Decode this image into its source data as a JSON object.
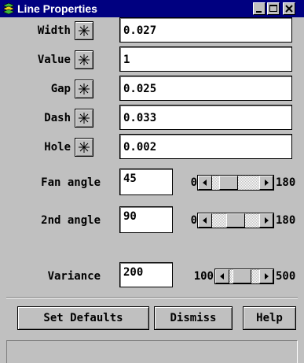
{
  "window": {
    "title": "Line Properties",
    "icon": "stacked-layers-icon",
    "controls": [
      "minimize-icon",
      "maximize-icon",
      "close-icon"
    ]
  },
  "properties": [
    {
      "label": "Width",
      "value": "0.027",
      "picker_icon": "crosshair-star-icon"
    },
    {
      "label": "Value",
      "value": "1",
      "picker_icon": "crosshair-star-icon"
    },
    {
      "label": "Gap",
      "value": "0.025",
      "picker_icon": "crosshair-star-icon"
    },
    {
      "label": "Dash",
      "value": "0.033",
      "picker_icon": "crosshair-star-icon"
    },
    {
      "label": "Hole",
      "value": "0.002",
      "picker_icon": "crosshair-star-icon"
    }
  ],
  "scales": [
    {
      "label": "Fan angle",
      "value": "45",
      "min": "0",
      "max": "180",
      "position": 0.25
    },
    {
      "label": "2nd angle",
      "value": "90",
      "min": "0",
      "max": "180",
      "position": 0.5
    },
    {
      "label": "Variance",
      "value": "200",
      "min": "100",
      "max": "500",
      "position": 0.25
    }
  ],
  "buttons": {
    "set_defaults": "Set Defaults",
    "dismiss": "Dismiss",
    "help": "Help"
  },
  "status_text": "",
  "colors": {
    "titlebar": "#000080",
    "face": "#c0c0c0",
    "field": "#ffffff"
  }
}
